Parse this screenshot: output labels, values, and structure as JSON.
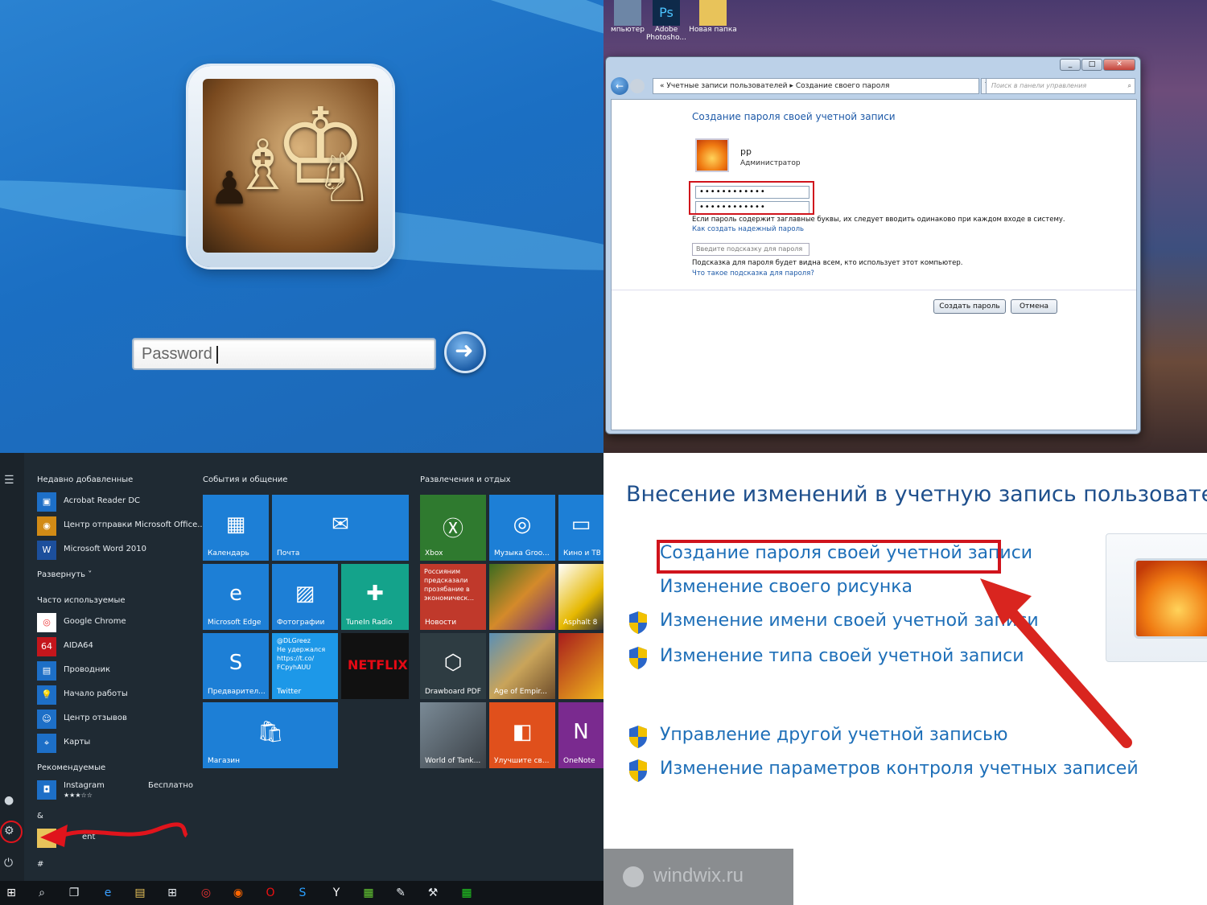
{
  "login": {
    "password_placeholder": "Password"
  },
  "dialog": {
    "desktop_icons": [
      {
        "label": "мпьютер"
      },
      {
        "label": "Adobe Photosho..."
      },
      {
        "label": "Новая папка"
      }
    ],
    "breadcrumb_prefix": "«",
    "breadcrumb_parent": "Учетные записи пользователей",
    "breadcrumb_sep": "▸",
    "breadcrumb_current": "Создание своего пароля",
    "search_placeholder": "Поиск в панели управления",
    "heading": "Создание пароля своей учетной записи",
    "user_name": "pp",
    "user_role": "Администратор",
    "password_mask": "••••••••••••",
    "confirm_mask": "••••••••••••",
    "caps_note": "Если пароль содержит заглавные буквы, их следует вводить одинаково при каждом входе в систему.",
    "strong_link": "Как создать надежный пароль",
    "hint_placeholder": "Введите подсказку для пароля",
    "hint_note": "Подсказка для пароля будет видна всем, кто использует этот компьютер.",
    "hint_link": "Что такое подсказка для пароля?",
    "create_button": "Создать пароль",
    "cancel_button": "Отмена"
  },
  "start": {
    "recent_header": "Недавно добавленные",
    "recent": [
      {
        "label": "Acrobat Reader DC",
        "icon": "acrobat-icon"
      },
      {
        "label": "Центр отправки Microsoft Office...",
        "icon": "office-upload-icon"
      },
      {
        "label": "Microsoft Word 2010",
        "icon": "word-icon"
      }
    ],
    "expand": "Развернуть ˅",
    "frequent_header": "Часто используемые",
    "frequent": [
      {
        "label": "Google Chrome",
        "icon": "chrome-icon"
      },
      {
        "label": "AIDA64",
        "icon": "aida64-icon"
      },
      {
        "label": "Проводник",
        "icon": "explorer-icon"
      },
      {
        "label": "Начало работы",
        "icon": "getstarted-icon"
      },
      {
        "label": "Центр отзывов",
        "icon": "feedback-icon"
      },
      {
        "label": "Карты",
        "icon": "maps-icon"
      }
    ],
    "recommended_header": "Рекомендуемые",
    "recommended_app": "Instagram",
    "recommended_price": "Бесплатно",
    "recommended_stars": "★★★☆☆",
    "amp": "&",
    "hash": "#",
    "partial_app": "ent",
    "group1": "События и общение",
    "group2": "Развлечения и отдых",
    "tiles": [
      {
        "label": "Календарь"
      },
      {
        "label": "Почта"
      },
      {
        "label": "Microsoft Edge"
      },
      {
        "label": "Фотографии"
      },
      {
        "label": "TuneIn Radio"
      },
      {
        "label": "Предварител..."
      },
      {
        "label": "Twitter",
        "text": "@DLGreez\nНе удержался\nhttps://t.co/\nFCpyhAUU"
      },
      {
        "label": "NETFLIX"
      },
      {
        "label": "Магазин"
      },
      {
        "label": "Xbox"
      },
      {
        "label": "Музыка Groo..."
      },
      {
        "label": "Кино и ТВ"
      },
      {
        "label": "Новости",
        "text": "Россияним предсказали прозябание в экономическ..."
      },
      {
        "label": ""
      },
      {
        "label": "Asphalt 8"
      },
      {
        "label": "Drawboard PDF"
      },
      {
        "label": "Age of Empir..."
      },
      {
        "label": ""
      },
      {
        "label": "World of Tank..."
      },
      {
        "label": "Улучшите св..."
      },
      {
        "label": "OneNote"
      }
    ]
  },
  "account": {
    "title": "Внесение изменений в учетную запись пользователя",
    "links": [
      "Создание пароля своей учетной записи",
      "Изменение своего рисунка",
      "Изменение имени своей учетной записи",
      "Изменение типа своей учетной записи",
      "Управление другой учетной записью",
      "Изменение параметров контроля учетных записей"
    ],
    "watermark": "windwix.ru"
  },
  "colors": {
    "highlight_red": "#d0141c",
    "link_blue": "#1e6fb8",
    "tile_blue": "#1d7fd6"
  }
}
